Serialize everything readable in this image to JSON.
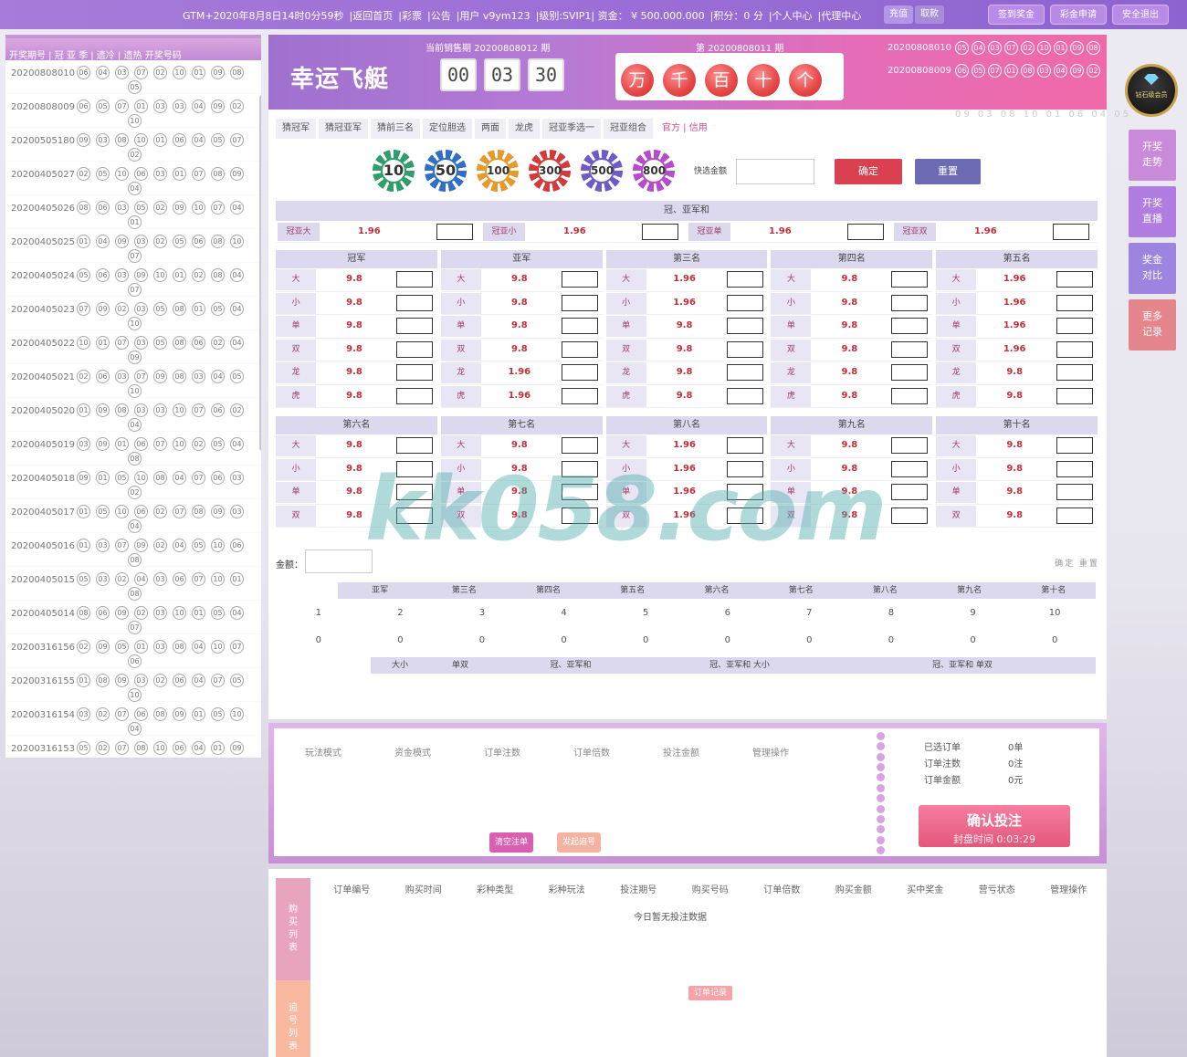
{
  "topbar": {
    "info": [
      "GTM+2020年8月8日14时0分59秒",
      "|返回首页",
      "|彩票",
      "|公告",
      "|用户 v9ym123",
      "|级别:SVIP1| 资金： ¥ 500.000.000",
      "|积分：0 分",
      "|个人中心",
      "|代理中心"
    ],
    "recharge": "充值",
    "withdraw": "取款",
    "right_buttons": [
      "签到奖金",
      "彩金申请",
      "安全退出"
    ]
  },
  "history": {
    "header": "开奖期号 | 冠  亚  季 | 遗冷 | 遗热      开奖号码",
    "rows": [
      {
        "id": "20200808010",
        "balls": [
          "06",
          "04",
          "03",
          "07",
          "02",
          "10",
          "01",
          "09",
          "08"
        ],
        "extra": "05"
      },
      {
        "id": "20200808009",
        "balls": [
          "06",
          "05",
          "07",
          "01",
          "03",
          "03",
          "04",
          "09",
          "02"
        ],
        "extra": "10"
      },
      {
        "id": "20200505180",
        "balls": [
          "09",
          "03",
          "08",
          "10",
          "01",
          "06",
          "04",
          "05",
          "07"
        ],
        "extra": "02"
      },
      {
        "id": "20200405027",
        "balls": [
          "02",
          "05",
          "10",
          "06",
          "03",
          "01",
          "07",
          "08",
          "09"
        ],
        "extra": "04"
      },
      {
        "id": "20200405026",
        "balls": [
          "08",
          "06",
          "03",
          "05",
          "02",
          "09",
          "10",
          "07",
          "04"
        ],
        "extra": "01"
      },
      {
        "id": "20200405025",
        "balls": [
          "01",
          "04",
          "09",
          "03",
          "02",
          "05",
          "06",
          "08",
          "10"
        ],
        "extra": "07"
      },
      {
        "id": "20200405024",
        "balls": [
          "05",
          "06",
          "03",
          "09",
          "10",
          "01",
          "02",
          "08",
          "04"
        ],
        "extra": "07"
      },
      {
        "id": "20200405023",
        "balls": [
          "07",
          "09",
          "02",
          "03",
          "05",
          "08",
          "01",
          "05",
          "04"
        ],
        "extra": "10"
      },
      {
        "id": "20200405022",
        "balls": [
          "10",
          "01",
          "07",
          "03",
          "05",
          "08",
          "06",
          "02",
          "04"
        ],
        "extra": "09"
      },
      {
        "id": "20200405021",
        "balls": [
          "02",
          "06",
          "03",
          "07",
          "09",
          "08",
          "03",
          "04",
          "05"
        ],
        "extra": "10"
      },
      {
        "id": "20200405020",
        "balls": [
          "01",
          "09",
          "08",
          "03",
          "03",
          "10",
          "07",
          "06",
          "02"
        ],
        "extra": "04"
      },
      {
        "id": "20200405019",
        "balls": [
          "03",
          "09",
          "01",
          "06",
          "07",
          "10",
          "02",
          "05",
          "04"
        ],
        "extra": "08"
      },
      {
        "id": "20200405018",
        "balls": [
          "09",
          "01",
          "05",
          "10",
          "08",
          "04",
          "07",
          "06",
          "03"
        ],
        "extra": "02"
      },
      {
        "id": "20200405017",
        "balls": [
          "01",
          "05",
          "10",
          "06",
          "02",
          "07",
          "08",
          "09",
          "03"
        ],
        "extra": "04"
      },
      {
        "id": "20200405016",
        "balls": [
          "01",
          "03",
          "07",
          "09",
          "02",
          "04",
          "05",
          "10",
          "06"
        ],
        "extra": "08"
      },
      {
        "id": "20200405015",
        "balls": [
          "05",
          "03",
          "02",
          "04",
          "03",
          "06",
          "07",
          "10",
          "01"
        ],
        "extra": "08"
      },
      {
        "id": "20200405014",
        "balls": [
          "08",
          "06",
          "09",
          "02",
          "03",
          "10",
          "01",
          "05",
          "04"
        ],
        "extra": "07"
      },
      {
        "id": "20200316156",
        "balls": [
          "02",
          "09",
          "05",
          "01",
          "03",
          "08",
          "04",
          "10",
          "07"
        ],
        "extra": "06"
      },
      {
        "id": "20200316155",
        "balls": [
          "01",
          "08",
          "09",
          "03",
          "02",
          "06",
          "04",
          "07",
          "05"
        ],
        "extra": "10"
      },
      {
        "id": "20200316154",
        "balls": [
          "03",
          "02",
          "07",
          "06",
          "08",
          "09",
          "01",
          "05",
          "10"
        ],
        "extra": "04"
      },
      {
        "id": "20200316153",
        "balls": [
          "05",
          "02",
          "07",
          "08",
          "10",
          "06",
          "04",
          "01",
          "09"
        ],
        "extra": ""
      }
    ]
  },
  "header": {
    "logo": "幸运飞艇",
    "current_period": "当前销售期 20200808012 期",
    "timer": [
      "00",
      "03",
      "30"
    ],
    "prev_period": "第 20200808011 期",
    "digits": [
      "万",
      "千",
      "百",
      "十",
      "个"
    ],
    "recent": [
      {
        "id": "20200808010",
        "balls": [
          "05",
          "04",
          "03",
          "07",
          "02",
          "10",
          "01",
          "09",
          "08"
        ]
      },
      {
        "id": "20200808009",
        "balls": [
          "06",
          "05",
          "07",
          "01",
          "08",
          "03",
          "04",
          "09",
          "02"
        ]
      }
    ],
    "recent_partial": "09 03 08 10 01 06 04 05"
  },
  "tabs": [
    "猜冠军",
    "猜冠亚军",
    "猜前三名",
    "定位胆选",
    "两面",
    "龙虎",
    "冠亚季选一",
    "冠亚组合",
    "官方 | 信用"
  ],
  "chips": [
    "10",
    "50",
    "100",
    "300",
    "500",
    "800"
  ],
  "quick": {
    "label": "快选金额",
    "ok": "确定",
    "reset": "重置"
  },
  "sum_section": {
    "title": "冠、亚军和",
    "items": [
      {
        "k": "冠亚大",
        "v": "1.96"
      },
      {
        "k": "冠亚小",
        "v": "1.96"
      },
      {
        "k": "冠亚单",
        "v": "1.96"
      },
      {
        "k": "冠亚双",
        "v": "1.96"
      }
    ]
  },
  "grid1": [
    {
      "title": "冠军",
      "rows": [
        [
          "大",
          "9.8"
        ],
        [
          "小",
          "9.8"
        ],
        [
          "单",
          "9.8"
        ],
        [
          "双",
          "9.8"
        ],
        [
          "龙",
          "9.8"
        ],
        [
          "虎",
          "9.8"
        ]
      ]
    },
    {
      "title": "亚军",
      "rows": [
        [
          "大",
          "9.8"
        ],
        [
          "小",
          "9.8"
        ],
        [
          "单",
          "9.8"
        ],
        [
          "双",
          "9.8"
        ],
        [
          "龙",
          "1.96"
        ],
        [
          "虎",
          "1.96"
        ]
      ]
    },
    {
      "title": "第三名",
      "rows": [
        [
          "大",
          "1.96"
        ],
        [
          "小",
          "1.96"
        ],
        [
          "单",
          "9.8"
        ],
        [
          "双",
          "9.8"
        ],
        [
          "龙",
          "9.8"
        ],
        [
          "虎",
          "9.8"
        ]
      ]
    },
    {
      "title": "第四名",
      "rows": [
        [
          "大",
          "9.8"
        ],
        [
          "小",
          "9.8"
        ],
        [
          "单",
          "9.8"
        ],
        [
          "双",
          "9.8"
        ],
        [
          "龙",
          "9.8"
        ],
        [
          "虎",
          "9.8"
        ]
      ]
    },
    {
      "title": "第五名",
      "rows": [
        [
          "大",
          "1.96"
        ],
        [
          "小",
          "1.96"
        ],
        [
          "单",
          "1.96"
        ],
        [
          "双",
          "1.96"
        ],
        [
          "龙",
          "9.8"
        ],
        [
          "虎",
          "9.8"
        ]
      ]
    }
  ],
  "grid2": [
    {
      "title": "第六名",
      "rows": [
        [
          "大",
          "9.8"
        ],
        [
          "小",
          "9.8"
        ],
        [
          "单",
          "9.8"
        ],
        [
          "双",
          "9.8"
        ]
      ]
    },
    {
      "title": "第七名",
      "rows": [
        [
          "大",
          "9.8"
        ],
        [
          "小",
          "9.8"
        ],
        [
          "单",
          "9.8"
        ],
        [
          "双",
          "9.8"
        ]
      ]
    },
    {
      "title": "第八名",
      "rows": [
        [
          "大",
          "1.96"
        ],
        [
          "小",
          "1.96"
        ],
        [
          "单",
          "1.96"
        ],
        [
          "双",
          "1.96"
        ]
      ]
    },
    {
      "title": "第九名",
      "rows": [
        [
          "大",
          "9.8"
        ],
        [
          "小",
          "9.8"
        ],
        [
          "单",
          "9.8"
        ],
        [
          "双",
          "9.8"
        ]
      ]
    },
    {
      "title": "第十名",
      "rows": [
        [
          "大",
          "9.8"
        ],
        [
          "小",
          "9.8"
        ],
        [
          "单",
          "9.8"
        ],
        [
          "双",
          "9.8"
        ]
      ]
    }
  ],
  "amount": {
    "label": "金额：",
    "confirm": "确定 重置"
  },
  "counter": {
    "heads": [
      "亚军",
      "第三名",
      "第四名",
      "第五名",
      "第六名",
      "第七名",
      "第八名",
      "第九名",
      "第十名"
    ],
    "row1": [
      "1",
      "2",
      "3",
      "4",
      "5",
      "6",
      "7",
      "8",
      "9",
      "10"
    ],
    "row2": [
      "0",
      "0",
      "0",
      "0",
      "0",
      "0",
      "0",
      "0",
      "0",
      "0"
    ],
    "heads2": [
      "大小",
      "单双",
      "冠、亚军和",
      "冠、亚军和 大小",
      "冠、亚军和 单双"
    ]
  },
  "order": {
    "heads": [
      "玩法模式",
      "资金模式",
      "订单注数",
      "订单倍数",
      "投注金额",
      "管理操作"
    ],
    "clear": "清空注单",
    "track": "发起追号",
    "stats": [
      {
        "k": "已选订单",
        "v": "0单"
      },
      {
        "k": "订单注数",
        "v": "0注"
      },
      {
        "k": "订单金额",
        "v": "0元"
      }
    ],
    "confirm": "确认投注",
    "close_time": "封盘时间 0:03:29"
  },
  "list": {
    "side1": "购买列表",
    "side2": "追号列表",
    "heads": [
      "订单编号",
      "购买时间",
      "彩种类型",
      "彩种玩法",
      "投注期号",
      "购买号码",
      "订单倍数",
      "购买金额",
      "买中奖金",
      "营亏状态",
      "管理操作"
    ],
    "empty": "今日暂无投注数据",
    "record_btn": "订单记录"
  },
  "right_panel": {
    "badge": "钻石级会员",
    "buttons": [
      "开奖走势",
      "开奖直播",
      "奖金对比",
      "更多记录"
    ]
  },
  "watermark": "kk058.com"
}
